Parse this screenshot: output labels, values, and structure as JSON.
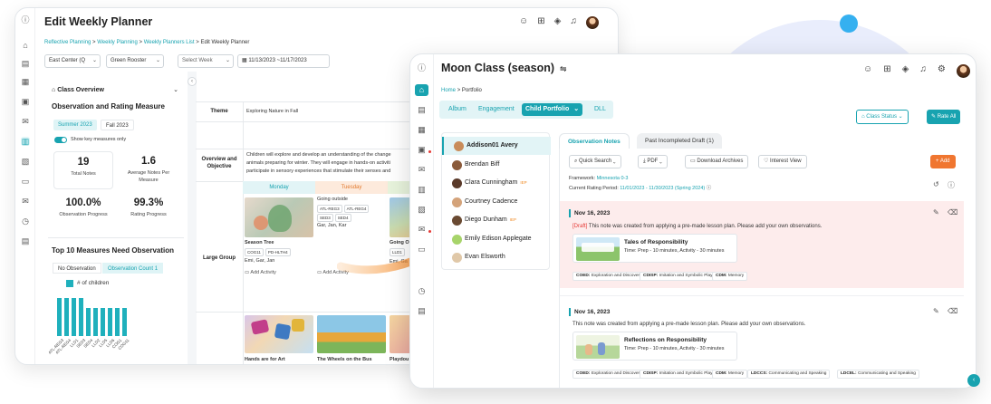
{
  "planner": {
    "title": "Edit Weekly Planner",
    "breadcrumb": [
      "Reflective Planning",
      "Weekly Planning",
      "Weekly Planners List",
      "Edit Weekly Planner"
    ],
    "breadcrumb_sep": ">",
    "filters": {
      "center": "East Center (Q",
      "classroom": "Green Rooster",
      "week_placeholder": "Select Week",
      "date_range": "11/13/2023 ~11/17/2023"
    },
    "class_overview": {
      "title": "Class Overview",
      "section_title": "Observation and Rating Measure",
      "period_chips": [
        "Summer 2023",
        "Fall 2023"
      ],
      "toggle_label": "Show key measures only",
      "stats": [
        {
          "value": "19",
          "label": "Total Notes"
        },
        {
          "value": "1.6",
          "label": "Average Notes Per Measure"
        },
        {
          "value": "100.0%",
          "label": "Observation Progress"
        },
        {
          "value": "99.3%",
          "label": "Rating Progress"
        }
      ],
      "top_measures_title": "Top 10 Measures Need Observation",
      "measure_tabs": [
        "No Observation",
        "Observation Count 1"
      ],
      "legend": "# of children"
    },
    "grid": {
      "theme_label": "Theme",
      "theme_value": "Exploring Nature in Fall",
      "overview_label": "Overview and Objective",
      "overview_lines": [
        "Children will explore and develop an understanding of the change",
        "animals preparing for winter. They will engage in hands-on activiti",
        "participate in sensory experiences that stimulate their senses and"
      ],
      "days": [
        "Monday",
        "Tuesday"
      ],
      "row_label": "Large Group",
      "monday": {
        "title": "Season Tree",
        "tags": [
          "COG11",
          "PD-HLTH4"
        ],
        "people": "Emi, Gar, Jan",
        "add": "Add Activity"
      },
      "tuesday": {
        "title": "Going outside",
        "tags": [
          "ATL-REG3",
          "ATL-REG4",
          "SED3",
          "SED4"
        ],
        "people": "Gar, Jan, Kar",
        "add": "Add Activity"
      },
      "wednesday": {
        "title": "Going O",
        "tag": "LLD1",
        "people": "Emi, Ga"
      },
      "row2": [
        "Hands are for Art",
        "The Wheels on the Bus",
        "Playdou"
      ]
    }
  },
  "chart_data": {
    "type": "bar",
    "title": "",
    "categories": [
      "ATL-REG3",
      "ATL-REG4",
      "LLD1",
      "SED3",
      "SED4",
      "LLD2",
      "LLD5",
      "LLD6",
      "COG1",
      "COG11"
    ],
    "series": [
      {
        "name": "# of children",
        "values": [
          4,
          4,
          4,
          4,
          3,
          3,
          3,
          3,
          3,
          3
        ]
      }
    ],
    "xlabel": "",
    "ylabel": "",
    "ylim": [
      0,
      4
    ],
    "legend": "top-left",
    "color": "#1fb0bc"
  },
  "portfolio": {
    "title": "Moon Class (season)",
    "breadcrumb": [
      "Home",
      "Portfolio"
    ],
    "tabs": [
      "Album",
      "Engagement",
      "Child Portfolio",
      "DLL"
    ],
    "active_tab": "Child Portfolio",
    "class_status": "Class Status",
    "rate_all": "Rate All",
    "children": [
      {
        "name": "Addison01 Avery",
        "selected": true,
        "iep": ""
      },
      {
        "name": "Brendan Biff",
        "selected": false,
        "iep": ""
      },
      {
        "name": "Clara Cunningham",
        "selected": false,
        "iep": "IEP"
      },
      {
        "name": "Courtney Cadence",
        "selected": false,
        "iep": ""
      },
      {
        "name": "Diego Dunham",
        "selected": false,
        "iep": "IEP"
      },
      {
        "name": "Emily Edison Applegate",
        "selected": false,
        "iep": ""
      },
      {
        "name": "Evan Elsworth",
        "selected": false,
        "iep": ""
      }
    ],
    "note_tabs": [
      "Observation Notes",
      "Past Incompleted Draft (1)"
    ],
    "toolbar": {
      "quick_search": "Quick Search",
      "pdf": "PDF",
      "download": "Download Archives",
      "interest": "Interest View",
      "add": "Add"
    },
    "framework_label": "Framework:",
    "framework_value": "Minnesota 0-3",
    "period_label": "Current Rating Period:",
    "period_value": "11/01/2023 - 11/30/2023 (Spring 2024)",
    "notes": [
      {
        "date": "Nov 16, 2023",
        "draft": "[Draft]",
        "text": " This note was created from applying a pre-made lesson plan. Please add your own observations.",
        "plan_title": "Tales of Responsibility",
        "plan_time": "Time: Prep - 10 minutes, Activity - 30 minutes",
        "tags": [
          {
            "code": "COED:",
            "text": "Exploration and Discovery"
          },
          {
            "code": "CDISP:",
            "text": "Imitation and Symbolic Play"
          },
          {
            "code": "CDM:",
            "text": "Memory"
          }
        ]
      },
      {
        "date": "Nov 16, 2023",
        "draft": "",
        "text": "This note was created from applying a pre-made lesson plan. Please add your own observations.",
        "plan_title": "Reflections on Responsibility",
        "plan_time": "Time: Prep - 10 minutes, Activity - 30 minutes",
        "tags": [
          {
            "code": "COED:",
            "text": "Exploration and Discovery"
          },
          {
            "code": "CDISP:",
            "text": "Imitation and Symbolic Play"
          },
          {
            "code": "CDM:",
            "text": "Memory"
          },
          {
            "code": "LDCCS:",
            "text": "Communicating and Speaking"
          },
          {
            "code": "LDCEL:",
            "text": "Communicating and Speaking"
          }
        ]
      }
    ]
  },
  "colors": {
    "teal": "#18a3b0",
    "orange": "#f07630",
    "draft_bg": "#fdecec"
  }
}
